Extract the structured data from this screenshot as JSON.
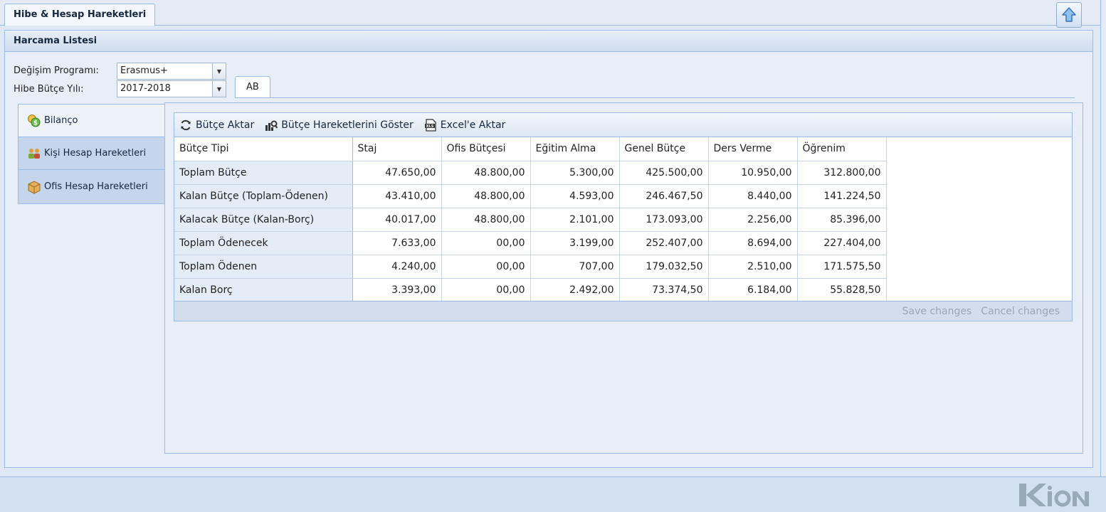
{
  "top_tab": {
    "label": "Hibe & Hesap Hareketleri"
  },
  "panel": {
    "title": "Harcama Listesi"
  },
  "form": {
    "program_label": "Değişim Programı:",
    "program_value": "Erasmus+",
    "year_label": "Hibe Bütçe Yılı:",
    "year_value": "2017-2018"
  },
  "inner_tab": {
    "label": "AB"
  },
  "nav": {
    "items": [
      {
        "label": "Bilanço",
        "icon": "money-icon"
      },
      {
        "label": "Kişi Hesap Hareketleri",
        "icon": "users-icon"
      },
      {
        "label": "Ofis Hesap Hareketleri",
        "icon": "box-icon"
      }
    ]
  },
  "toolbar": {
    "transfer_label": "Bütçe Aktar",
    "show_label": "Bütçe Hareketlerini Göster",
    "excel_label": "Excel'e Aktar"
  },
  "grid": {
    "columns": [
      "Bütçe Tipi",
      "Staj",
      "Ofis Bütçesi",
      "Eğitim Alma",
      "Genel Bütçe",
      "Ders Verme",
      "Öğrenim"
    ],
    "rows": [
      {
        "label": "Toplam Bütçe",
        "values": [
          "47.650,00",
          "48.800,00",
          "5.300,00",
          "425.500,00",
          "10.950,00",
          "312.800,00"
        ]
      },
      {
        "label": "Kalan Bütçe (Toplam-Ödenen)",
        "values": [
          "43.410,00",
          "48.800,00",
          "4.593,00",
          "246.467,50",
          "8.440,00",
          "141.224,50"
        ]
      },
      {
        "label": "Kalacak Bütçe (Kalan-Borç)",
        "values": [
          "40.017,00",
          "48.800,00",
          "2.101,00",
          "173.093,00",
          "2.256,00",
          "85.396,00"
        ]
      },
      {
        "label": "Toplam Ödenecek",
        "values": [
          "7.633,00",
          "00,00",
          "3.199,00",
          "252.407,00",
          "8.694,00",
          "227.404,00"
        ]
      },
      {
        "label": "Toplam Ödenen",
        "values": [
          "4.240,00",
          "00,00",
          "707,00",
          "179.032,50",
          "2.510,00",
          "171.575,50"
        ]
      },
      {
        "label": "Kalan Borç",
        "values": [
          "3.393,00",
          "00,00",
          "2.492,00",
          "73.374,50",
          "6.184,00",
          "55.828,50"
        ]
      }
    ],
    "save_label": "Save changes",
    "cancel_label": "Cancel changes"
  }
}
